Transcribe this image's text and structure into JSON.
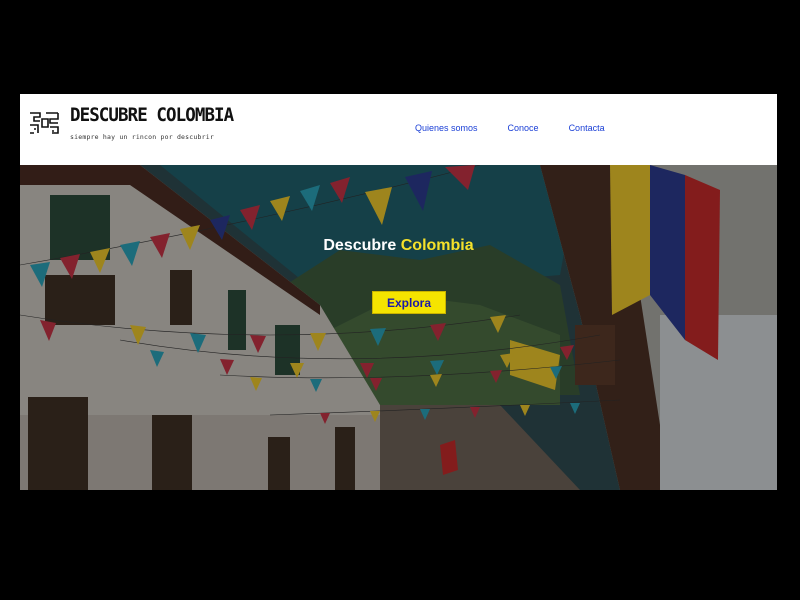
{
  "brand": {
    "name": "DESCUBRE COLOMBIA",
    "tagline": "siempre hay un rincon por descubrir",
    "logo_icon": "pre-columbian-pattern-icon"
  },
  "nav": {
    "items": [
      {
        "label": "Quienes somos"
      },
      {
        "label": "Conoce"
      },
      {
        "label": "Contacta"
      }
    ]
  },
  "hero": {
    "title_prefix": "Descubre",
    "title_accent": "Colombia",
    "cta_label": "Explora",
    "background": "colonial-street-with-bunting-flags-photo"
  },
  "colors": {
    "accent_yellow": "#f5e400",
    "nav_link": "#1a3fd6",
    "cta_text": "#1b1aa6"
  }
}
